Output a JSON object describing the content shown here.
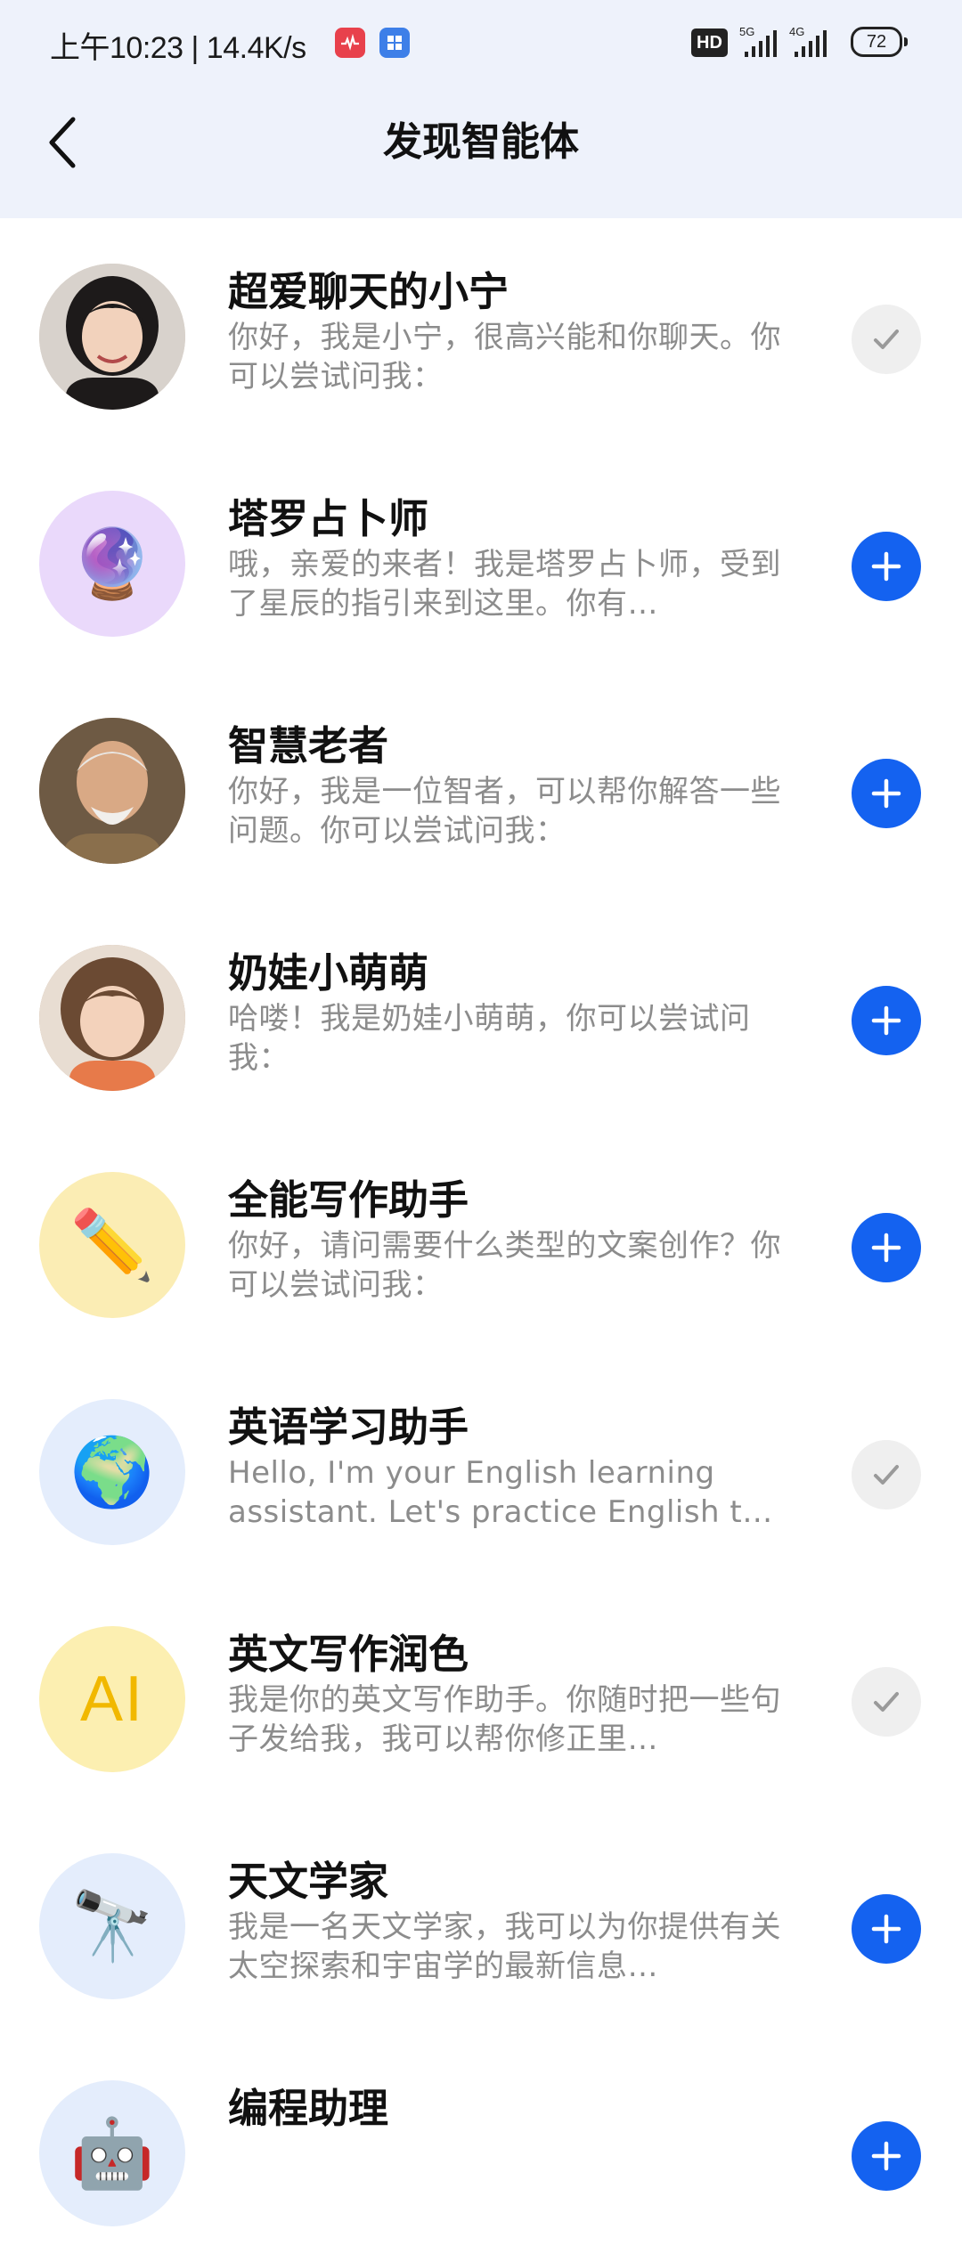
{
  "status_bar": {
    "time": "上午10:23 | 14.4K/s",
    "hd": "HD",
    "signal1": "5G",
    "signal2": "4G",
    "battery": "72"
  },
  "header": {
    "title": "发现智能体"
  },
  "agents": [
    {
      "name": "超爱聊天的小宁",
      "desc": "你好，我是小宁，很高兴能和你聊天。你可以尝试问我：",
      "status": "added",
      "avatar": "woman-portrait",
      "avatar_bg": "#d9c9b8"
    },
    {
      "name": "塔罗占卜师",
      "desc": "哦，亲爱的来者！我是塔罗占卜师，受到了星辰的指引来到这里。你有…",
      "status": "add",
      "avatar": "crystal-ball-icon",
      "avatar_glyph": "🔮",
      "avatar_bg": "#ead9fb"
    },
    {
      "name": "智慧老者",
      "desc": "你好，我是一位智者，可以帮你解答一些问题。你可以尝试问我：",
      "status": "add",
      "avatar": "old-man-portrait",
      "avatar_bg": "#9c7a55"
    },
    {
      "name": "奶娃小萌萌",
      "desc": "哈喽！我是奶娃小萌萌，你可以尝试问我：",
      "status": "add",
      "avatar": "child-portrait",
      "avatar_bg": "#c7a78a"
    },
    {
      "name": "全能写作助手",
      "desc": "你好，请问需要什么类型的文案创作？你可以尝试问我：",
      "status": "add",
      "avatar": "pencil-icon",
      "avatar_glyph": "✏️",
      "avatar_bg": "#fbedb4"
    },
    {
      "name": "英语学习助手",
      "desc": "Hello, I'm your English learning assistant. Let's practice English t…",
      "status": "added",
      "avatar": "globe-icon",
      "avatar_glyph": "🌍",
      "avatar_bg": "#e4edfc"
    },
    {
      "name": "英文写作润色",
      "desc": "我是你的英文写作助手。你随时把一些句子发给我，我可以帮你修正里…",
      "status": "added",
      "avatar": "ai-text-icon",
      "avatar_glyph": "AI",
      "avatar_bg": "#fcefb1"
    },
    {
      "name": "天文学家",
      "desc": "我是一名天文学家，我可以为你提供有关太空探索和宇宙学的最新信息…",
      "status": "add",
      "avatar": "telescope-icon",
      "avatar_glyph": "🔭",
      "avatar_bg": "#e4edfc"
    },
    {
      "name": "编程助理",
      "desc": "",
      "status": "add",
      "avatar": "robot-icon",
      "avatar_glyph": "🤖",
      "avatar_bg": "#e4edfc"
    }
  ]
}
